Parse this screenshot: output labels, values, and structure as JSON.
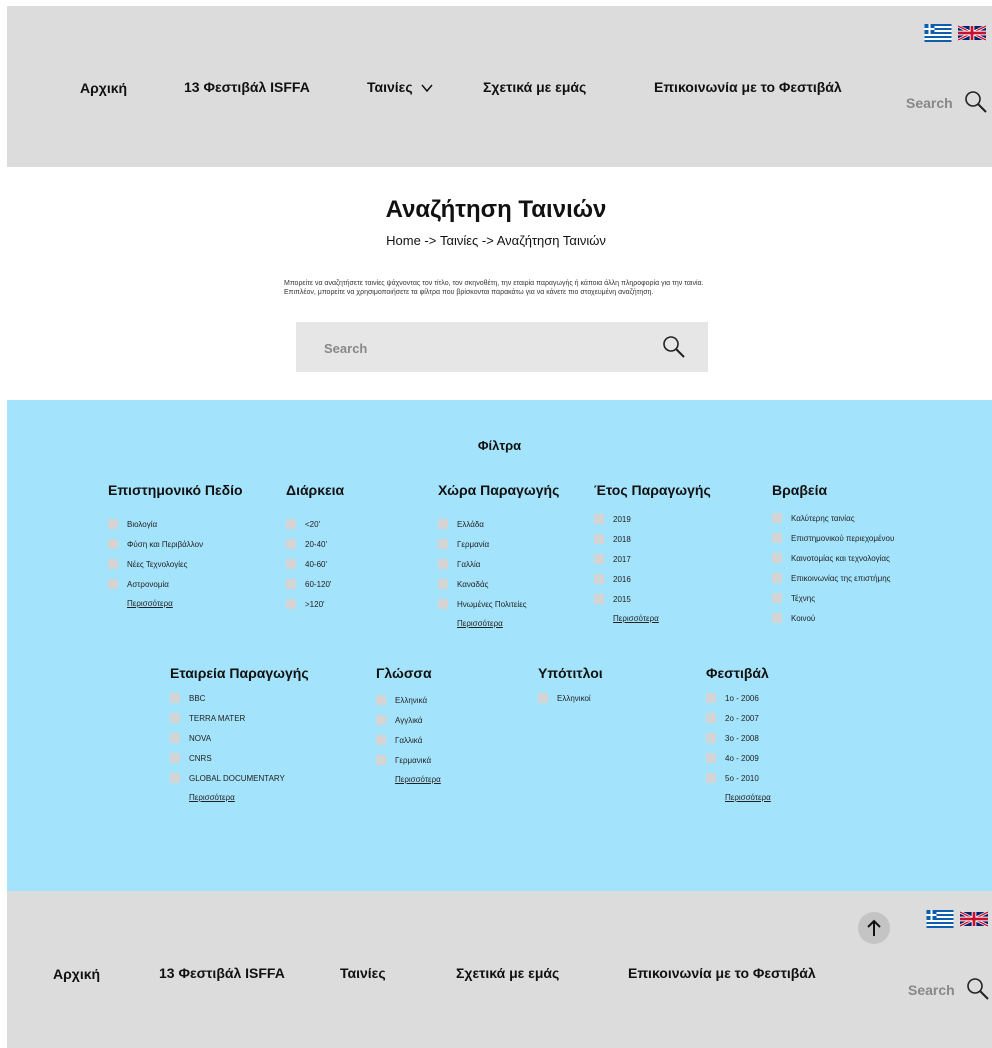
{
  "header": {
    "nav": [
      "Αρχική",
      "13 Φεστιβάλ ISFFA",
      "Ταινίες",
      "Σχετικά με εμάς",
      "Επικοινωνία με το Φεστιβάλ"
    ],
    "search_label": "Search"
  },
  "page": {
    "title": "Αναζήτηση Ταινιών",
    "breadcrumb": "Home -> Ταινίες -> Αναζήτηση Ταινιών",
    "description": "Μπορείτε να αναζητήσετε ταινίες ψάχνοντας τον τίτλο, τον σκηνοθέτη, την εταιρία παραγωγής ή κάποια άλλη πληροφορία για την ταινία. Επιπλέον, μπορείτε να χρησιμοποιήσετε τα φίλτρα που βρίσκονται παρακάτω για να κάνετε πιο στοχευμένη αναζήτηση.",
    "search_placeholder": "Search"
  },
  "filters": {
    "title": "Φίλτρα",
    "more_label": "Περισσότερα",
    "groups": [
      {
        "title": "Επιστημονικό Πεδίο",
        "items": [
          "Βιολογία",
          "Φύση και Περιβάλλον",
          "Νέες Τεχνολογίες",
          "Αστρονομία"
        ]
      },
      {
        "title": "Διάρκεια",
        "items": [
          "<20'",
          "20-40'",
          "40-60'",
          "60-120'",
          ">120'"
        ]
      },
      {
        "title": "Χώρα Παραγωγής",
        "items": [
          "Ελλάδα",
          "Γερμανία",
          "Γαλλία",
          "Καναδάς",
          "Ηνωμένες Πολιτείες"
        ]
      },
      {
        "title": "Έτος Παραγωγής",
        "items": [
          "2019",
          "2018",
          "2017",
          "2016",
          "2015"
        ]
      },
      {
        "title": "Βραβεία",
        "items": [
          "Καλύτερης ταινίας",
          "Επιστημονικού περιεχομένου",
          "Καινοτομίας και τεχνολογίας",
          "Επικοινωνίας της επιστήμης",
          "Τέχνης",
          "Κοινού"
        ]
      },
      {
        "title": "Εταιρεία Παραγωγής",
        "items": [
          "BBC",
          "TERRA MATER",
          "NOVA",
          "CNRS",
          "GLOBAL DOCUMENTARY"
        ]
      },
      {
        "title": "Γλώσσα",
        "items": [
          "Ελληνικά",
          "Αγγλικά",
          "Γαλλικά",
          "Γερμανικά"
        ]
      },
      {
        "title": "Υπότιτλοι",
        "items": [
          "Ελληνικοί"
        ]
      },
      {
        "title": "Φεστιβάλ",
        "items": [
          "1ο - 2006",
          "2ο - 2007",
          "3ο - 2008",
          "4ο - 2009",
          "5ο - 2010"
        ]
      }
    ]
  },
  "footer": {
    "nav": [
      "Αρχική",
      "13 Φεστιβάλ ISFFA",
      "Ταινίες",
      "Σχετικά με εμάς",
      "Επικοινωνία με το Φεστιβάλ"
    ],
    "search_label": "Search"
  },
  "colors": {
    "header_bg": "#dcdcdc",
    "filters_bg": "#a4e3fc",
    "checkbox": "#d4d4d4"
  },
  "icons": [
    "greek-flag-icon",
    "uk-flag-icon",
    "search-icon",
    "chevron-down-icon",
    "arrow-up-icon"
  ]
}
